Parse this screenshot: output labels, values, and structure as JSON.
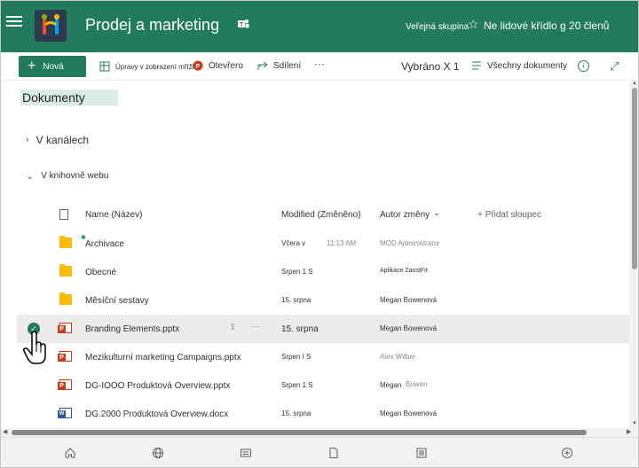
{
  "header": {
    "site_title": "Prodej a marketing",
    "group_type": "Veřejná skupina",
    "follow_text": "Ne lidové křídlo g 20 členů"
  },
  "commandbar": {
    "new_label": "Nová",
    "grid_label": "Úpravy v zobrazení mřížky",
    "open_label": "Otevřero",
    "share_label": "Sdílení",
    "more_label": "···",
    "selected_label": "Vybráno X 1",
    "all_docs_label": "Všechny dokumenty"
  },
  "content": {
    "doc_title": "Dokumenty",
    "section_channels": "V kanálech",
    "section_library": "V knihovně webu",
    "columns": {
      "name": "Name (Název)",
      "modified": "Modified (Změněno)",
      "author": "Autor změny",
      "add": "+ Přidat sloupec"
    },
    "rows": [
      {
        "name": "Archivace",
        "modified": "Včera v",
        "time": "11:13 AM",
        "author": "MOD Administrator",
        "type": "folder"
      },
      {
        "name": "Obecné",
        "modified": "Srpen 1 S",
        "time": "",
        "author": "Aplikace ZaostFit",
        "type": "folder"
      },
      {
        "name": "Měsíční sestavy",
        "modified": "15. srpna",
        "time": "",
        "author": "Megan Bowenová",
        "type": "folder"
      },
      {
        "name": "Branding Elements.pptx",
        "modified": "15. srpna",
        "time": "",
        "author": "Megan Bowenová",
        "type": "ppt"
      },
      {
        "name": "Mezikulturní marketing Campaigns.pptx",
        "modified": "Srpen I S",
        "time": "",
        "author": "Alex Wilber",
        "type": "ppt"
      },
      {
        "name": "DG-IOOO Produktová Overview.pptx",
        "modified": "Srpen 1 S",
        "time": "",
        "author": "Megan",
        "author2": "Bowen",
        "type": "ppt"
      },
      {
        "name": "DG.2000 Produktová Overview.docx",
        "modified": "15. srpna",
        "time": "",
        "author": "Megan Bowenová",
        "type": "docx"
      }
    ]
  },
  "colors": {
    "brand": "#237b5f",
    "selected_row": "#edebe9"
  }
}
